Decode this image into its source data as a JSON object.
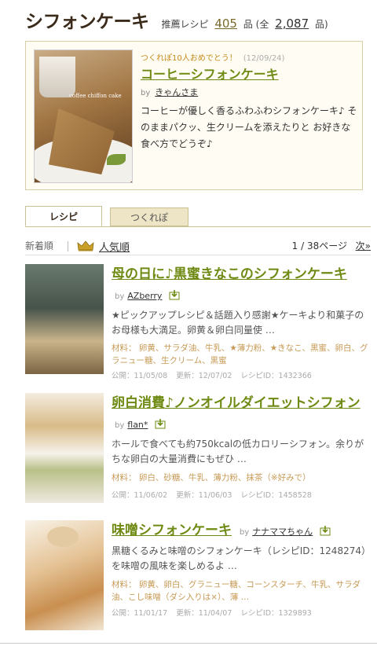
{
  "header": {
    "title": "シフォンケーキ",
    "recommended_label": "推薦レシピ",
    "recommended_count": "405",
    "unit": "品",
    "total_prefix": "(全",
    "total_count": "2,087",
    "total_suffix": "品)"
  },
  "featured": {
    "tag": "つくれぽ10人おめでとう！",
    "date": "(12/09/24)",
    "title": "コーヒーシフォンケーキ",
    "by_label": "by",
    "author": "きゃんさま",
    "description": "コーヒーが優しく香るふわふわシフォンケーキ♪ そのままパクッ、生クリームを添えたりと お好きな食べ方でどうぞ♪",
    "image_text": "coffee chiffon cake"
  },
  "tabs": [
    {
      "label": "レシピ"
    },
    {
      "label": "つくれぽ"
    }
  ],
  "sort": {
    "newest": "新着順",
    "popular": "人気順",
    "page": "1 / 38ページ",
    "next": "次»"
  },
  "recipes": [
    {
      "title": "母の日に♪黒蜜きなこのシフォンケーキ",
      "by_label": "by",
      "author": "AZberry",
      "description": "★ピックアップレシピ＆話題入り感謝★ケーキより和菓子のお母様も大満足。卵黄＆卵白同量使 …",
      "materials": "材料： 卵黄、サラダ油、牛乳、★薄力粉、★きなこ、黒蜜、卵白、グラニュー糖、生クリーム、黒蜜",
      "published": "公開：11/05/08",
      "updated": "更新：12/07/02",
      "recipe_id": "レシピID：1432366"
    },
    {
      "title": "卵白消費♪ノンオイルダイエットシフォン",
      "by_label": "by",
      "author": "flan*",
      "description": "ホールで食べても約750kcalの低カロリーシフォン。余りがちな卵白の大量消費にもぜひ …",
      "materials": "材料： 卵白、砂糖、牛乳、薄力粉、抹茶（※好みで）",
      "published": "公開：11/06/02",
      "updated": "更新：11/06/03",
      "recipe_id": "レシピID：1458528"
    },
    {
      "title": "味噌シフォンケーキ",
      "by_label": "by",
      "author": "ナナママちゃん",
      "description": "黒糖くるみと味噌のシフォンケーキ（レシピID：1248274）を味噌の風味を楽しめるよ …",
      "materials": "材料： 卵黄、卵白、グラニュー糖、コーンスターチ、牛乳、サラダ油、こし味噌（ダシ入りは×）、薄 …",
      "published": "公開：11/01/17",
      "updated": "更新：11/04/07",
      "recipe_id": "レシピID：1329893"
    }
  ],
  "colors": {
    "title_green": "#6e8a12",
    "material_orange": "#c79a55",
    "tab_bg": "#eee5c6"
  }
}
